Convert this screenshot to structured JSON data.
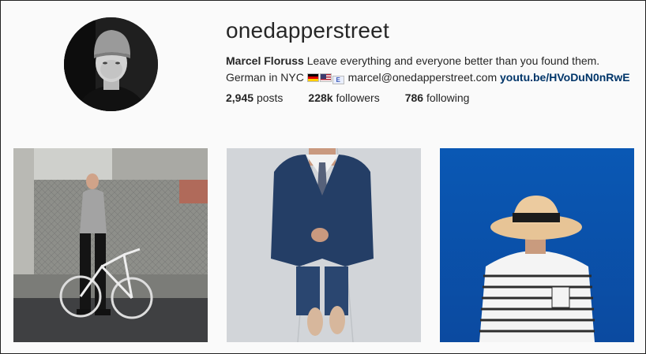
{
  "profile": {
    "username": "onedapperstreet",
    "full_name": "Marcel Floruss",
    "bio_text": " Leave everything and everyone better than you found them. German in NYC ",
    "email": "marcel@onedapperstreet.com",
    "link": "youtu.be/HVoDuN0nRwE",
    "flag_icons": [
      "german-flag-icon",
      "us-flag-icon",
      "e-badge-icon"
    ]
  },
  "stats": {
    "posts_count": "2,945",
    "posts_label": "posts",
    "followers_count": "228k",
    "followers_label": "followers",
    "following_count": "786",
    "following_label": "following"
  },
  "posts": [
    {
      "subject": "man-with-bicycle"
    },
    {
      "subject": "man-in-navy-suit"
    },
    {
      "subject": "man-in-straw-hat"
    }
  ],
  "colors": {
    "background": "#fafafa",
    "text": "#262626",
    "link": "#003569"
  }
}
